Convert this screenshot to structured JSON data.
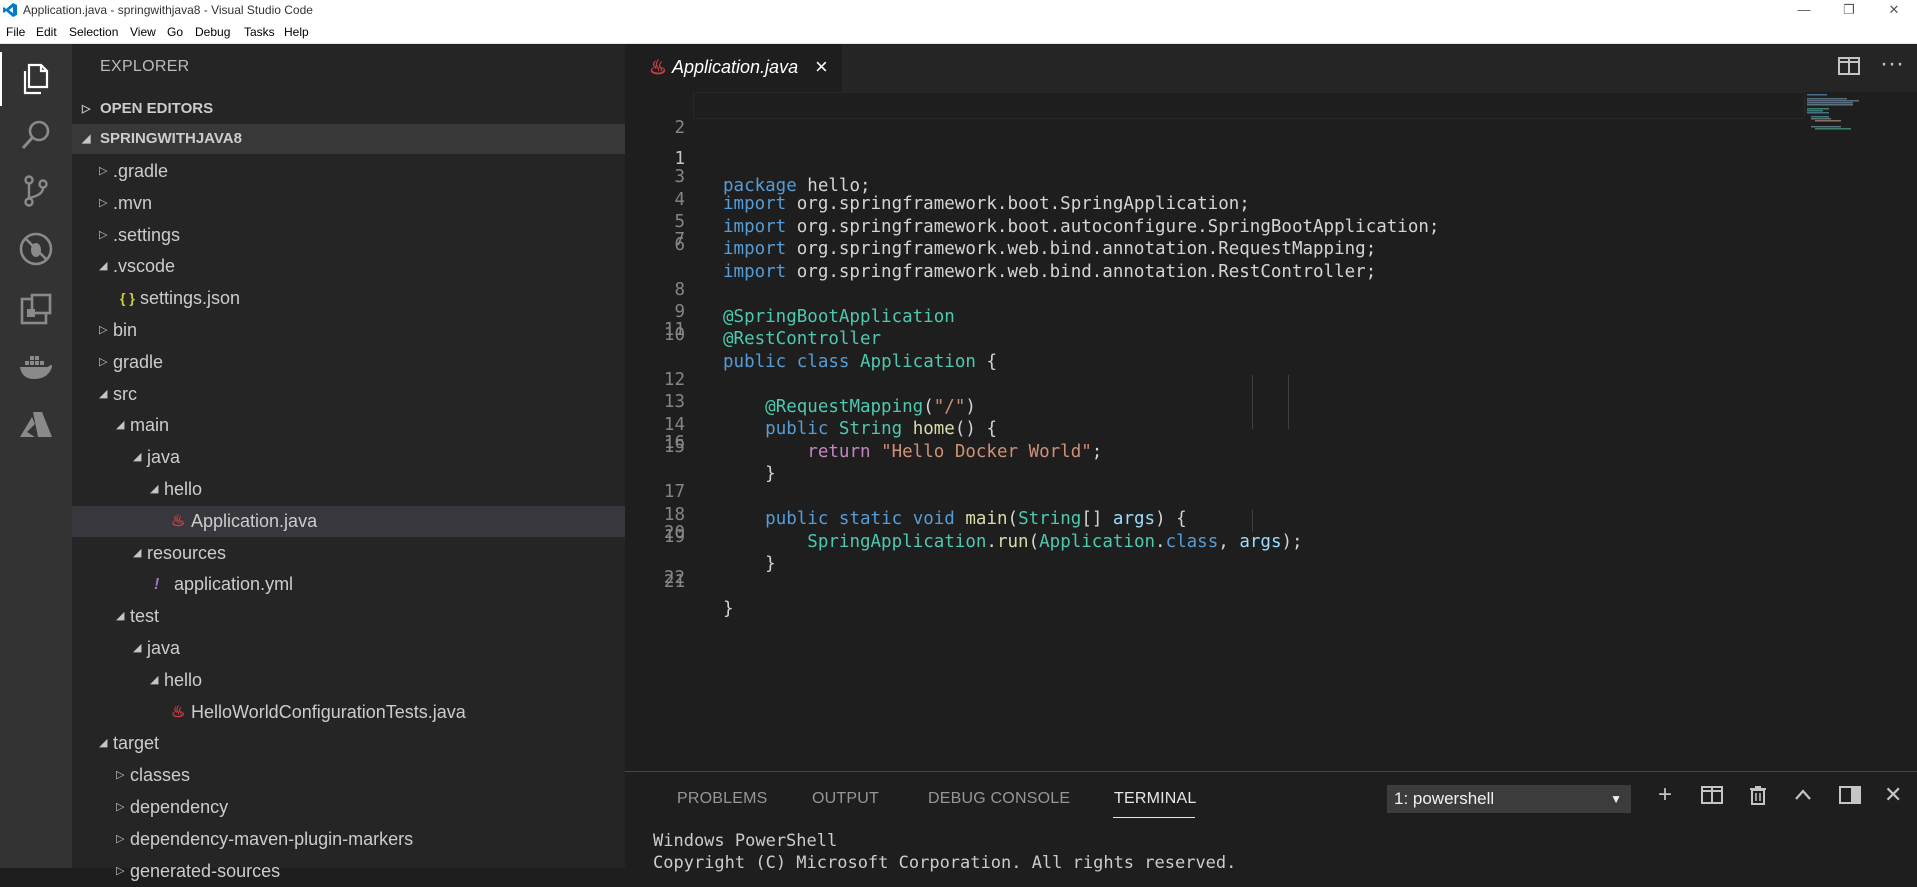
{
  "window": {
    "title": "Application.java - springwithjava8 - Visual Studio Code"
  },
  "menu": [
    "File",
    "Edit",
    "Selection",
    "View",
    "Go",
    "Debug",
    "Tasks",
    "Help"
  ],
  "activity": [
    "explorer-icon",
    "search-icon",
    "source-control-icon",
    "debug-icon",
    "extensions-icon",
    "docker-icon",
    "azure-icon"
  ],
  "sidebar": {
    "title": "EXPLORER",
    "open_editors": "OPEN EDITORS",
    "root": "SPRINGWITHJAVA8",
    "tree": [
      {
        "label": ".gradle",
        "type": "folder",
        "open": false
      },
      {
        "label": ".mvn",
        "type": "folder",
        "open": false
      },
      {
        "label": ".settings",
        "type": "folder",
        "open": false
      },
      {
        "label": ".vscode",
        "type": "folder",
        "open": true
      },
      {
        "label": "settings.json",
        "type": "json"
      },
      {
        "label": "bin",
        "type": "folder",
        "open": false
      },
      {
        "label": "gradle",
        "type": "folder",
        "open": false
      },
      {
        "label": "src",
        "type": "folder",
        "open": true
      },
      {
        "label": "main",
        "type": "folder",
        "open": true
      },
      {
        "label": "java",
        "type": "folder",
        "open": true
      },
      {
        "label": "hello",
        "type": "folder",
        "open": true
      },
      {
        "label": "Application.java",
        "type": "java"
      },
      {
        "label": "resources",
        "type": "folder",
        "open": true
      },
      {
        "label": "application.yml",
        "type": "yml"
      },
      {
        "label": "test",
        "type": "folder",
        "open": true
      },
      {
        "label": "java",
        "type": "folder",
        "open": true
      },
      {
        "label": "hello",
        "type": "folder",
        "open": true
      },
      {
        "label": "HelloWorldConfigurationTests.java",
        "type": "java"
      },
      {
        "label": "target",
        "type": "folder",
        "open": true
      },
      {
        "label": "classes",
        "type": "folder",
        "open": false
      },
      {
        "label": "dependency",
        "type": "folder",
        "open": false
      },
      {
        "label": "dependency-maven-plugin-markers",
        "type": "folder",
        "open": false
      },
      {
        "label": "generated-sources",
        "type": "folder",
        "open": false
      }
    ]
  },
  "editor": {
    "tab_label": "Application.java",
    "tab_icon": "java-file-icon",
    "line_numbers": [
      "1",
      "2",
      "3",
      "4",
      "5",
      "6",
      "7",
      "8",
      "9",
      "10",
      "11",
      "12",
      "13",
      "14",
      "15",
      "16",
      "17",
      "18",
      "19",
      "20",
      "21",
      "22"
    ],
    "code": {
      "l1_kw": "package",
      "l1_rest": " hello;",
      "l3_kw": "import",
      "l3_rest": " org.springframework.boot.SpringApplication;",
      "l4_kw": "import",
      "l4_rest": " org.springframework.boot.autoconfigure.SpringBootApplication;",
      "l5_kw": "import",
      "l5_rest": " org.springframework.web.bind.annotation.RequestMapping;",
      "l6_kw": "import",
      "l6_rest": " org.springframework.web.bind.annotation.RestController;",
      "l8": "@SpringBootApplication",
      "l9": "@RestController",
      "l10_kw1": "public",
      "l10_kw2": "class",
      "l10_ty": "Application",
      "l10_rest": " {",
      "l12_an": "@RequestMapping",
      "l12_p1": "(",
      "l12_str": "\"/\"",
      "l12_p2": ")",
      "l13_kw": "public",
      "l13_ty": "String",
      "l13_fn": "home",
      "l13_rest": "() {",
      "l14_kw": "return",
      "l14_str": "\"Hello Docker World\"",
      "l14_rest": ";",
      "l15": "}",
      "l17_kw1": "public",
      "l17_kw2": "static",
      "l17_kw3": "void",
      "l17_fn": "main",
      "l17_p1": "(",
      "l17_ty": "String",
      "l17_p2": "[] ",
      "l17_pr": "args",
      "l17_rest": ") {",
      "l18_ty": "SpringApplication",
      "l18_dot": ".",
      "l18_fn": "run",
      "l18_p1": "(",
      "l18_ty2": "Application",
      "l18_dot2": ".",
      "l18_kw": "class",
      "l18_p2": ", ",
      "l18_pr": "args",
      "l18_rest": ");",
      "l19": "}",
      "l21": "}"
    }
  },
  "panel": {
    "tabs": [
      "PROBLEMS",
      "OUTPUT",
      "DEBUG CONSOLE",
      "TERMINAL"
    ],
    "active_tab": "TERMINAL",
    "terminal_select": "1: powershell",
    "terminal_lines": [
      "Windows PowerShell",
      "Copyright (C) Microsoft Corporation. All rights reserved."
    ]
  },
  "colors": {
    "accent": "#007acc",
    "activitybar": "#333333",
    "sidebar": "#252526",
    "editor": "#1e1e1e"
  }
}
